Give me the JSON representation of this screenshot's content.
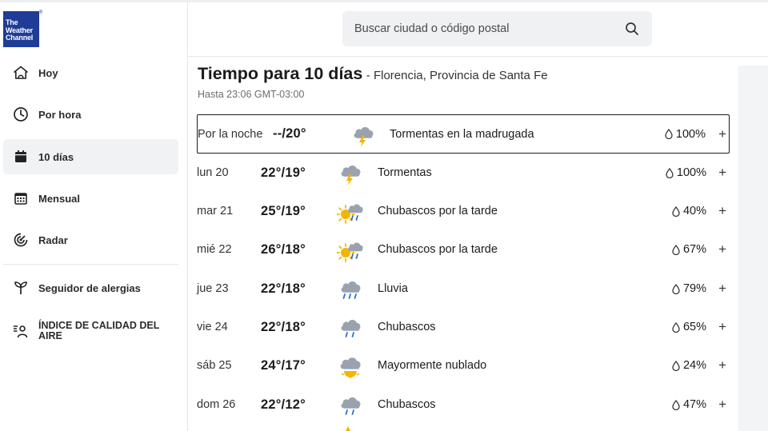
{
  "brand": {
    "logo_lines": [
      "The",
      "Weather",
      "Channel"
    ],
    "registered_mark": "®"
  },
  "sidebar": {
    "items": [
      {
        "label": "Hoy",
        "icon": "house-icon",
        "active": false
      },
      {
        "label": "Por hora",
        "icon": "clock-icon",
        "active": false
      },
      {
        "label": "10 días",
        "icon": "calendar-icon",
        "active": true
      },
      {
        "label": "Mensual",
        "icon": "calendar-grid-icon",
        "active": false
      },
      {
        "label": "Radar",
        "icon": "radar-icon",
        "active": false
      },
      {
        "label": "Seguidor de alergias",
        "icon": "plant-icon",
        "active": false
      },
      {
        "label": "ÍNDICE DE CALIDAD DEL AIRE",
        "icon": "air-quality-icon",
        "active": false
      }
    ]
  },
  "search": {
    "placeholder": "Buscar ciudad o código postal",
    "icon": "search-icon"
  },
  "forecast": {
    "title": "Tiempo para 10 días",
    "location": "- Florencia, Provincia de Santa Fe",
    "updated": "Hasta 23:06 GMT-03:00",
    "rows": [
      {
        "day": "Por la noche",
        "temp": "--/20°",
        "icon": "thunderstorm-icon",
        "desc": "Tormentas en la madrugada",
        "precip": "100%"
      },
      {
        "day": "lun 20",
        "temp": "22°/19°",
        "icon": "thunderstorm-icon",
        "desc": "Tormentas",
        "precip": "100%"
      },
      {
        "day": "mar 21",
        "temp": "25°/19°",
        "icon": "sun-rain-cloud-icon",
        "desc": "Chubascos por la tarde",
        "precip": "40%"
      },
      {
        "day": "mié 22",
        "temp": "26°/18°",
        "icon": "sun-rain-cloud-icon",
        "desc": "Chubascos por la tarde",
        "precip": "67%"
      },
      {
        "day": "jue 23",
        "temp": "22°/18°",
        "icon": "rain-cloud-icon",
        "desc": "Lluvia",
        "precip": "79%"
      },
      {
        "day": "vie 24",
        "temp": "22°/18°",
        "icon": "shower-cloud-icon",
        "desc": "Chubascos",
        "precip": "65%"
      },
      {
        "day": "sáb 25",
        "temp": "24°/17°",
        "icon": "mostly-cloudy-icon",
        "desc": "Mayormente nublado",
        "precip": "24%"
      },
      {
        "day": "dom 26",
        "temp": "22°/12°",
        "icon": "shower-cloud-icon",
        "desc": "Chubascos",
        "precip": "47%"
      }
    ],
    "expand_symbol": "+"
  },
  "colors": {
    "brand_blue": "#1f3c96",
    "bolt_yellow": "#f5b400",
    "cloud_gray": "#9aa3ad",
    "rain_blue": "#2f6fd0"
  }
}
